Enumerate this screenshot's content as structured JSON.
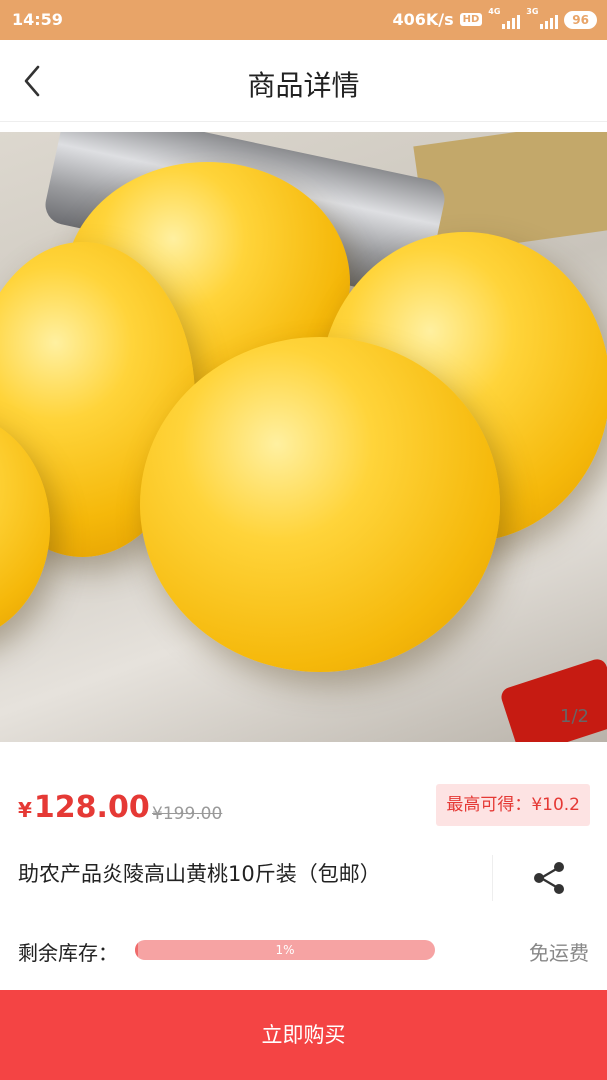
{
  "status_bar": {
    "time": "14:59",
    "speed": "406K/s",
    "hd": "HD",
    "net1": "4G",
    "net2": "3G",
    "battery": "96",
    "background": "#e8a468"
  },
  "nav": {
    "back_icon": "chevron-left-icon",
    "title": "商品详情"
  },
  "product": {
    "image_indicator": "1/2",
    "price_symbol": "¥",
    "price": "128.00",
    "original_price": "¥199.00",
    "earn_label": "最高可得：¥10.2",
    "title": "助农产品炎陵高山黄桃10斤装（包邮）",
    "share_icon": "share-icon",
    "stock_label": "剩余库存：",
    "stock_percent_text": "1%",
    "stock_percent": 1,
    "shipping": "免运费"
  },
  "actions": {
    "buy_label": "立即购买"
  },
  "colors": {
    "accent": "#f44444",
    "price": "#e53935",
    "earn_bg": "#fde3e3"
  }
}
